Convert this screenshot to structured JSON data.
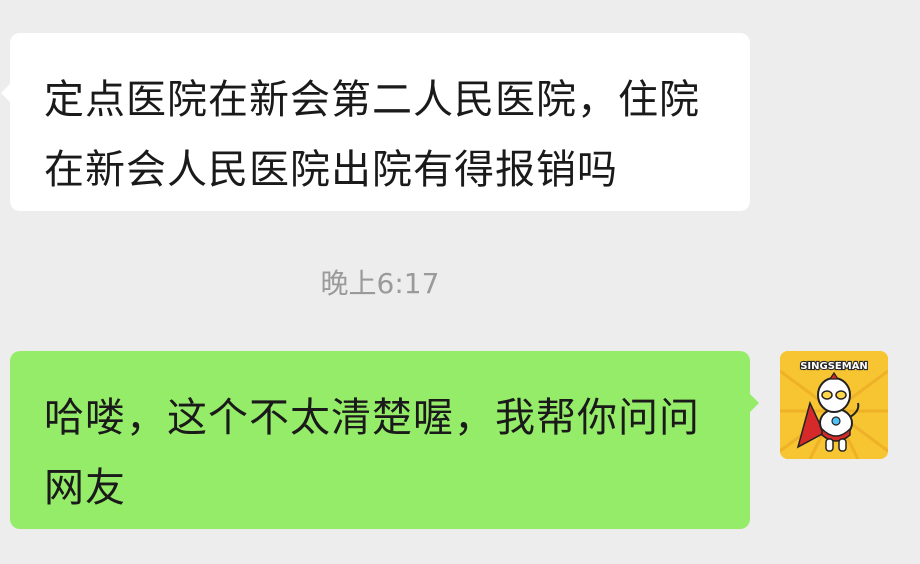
{
  "messages": [
    {
      "direction": "incoming",
      "text": "定点医院在新会第二人民医院，住院在新会人民医院出院有得报销吗"
    },
    {
      "direction": "outgoing",
      "text": "哈喽，这个不太清楚喔，我帮你问问网友"
    }
  ],
  "timestamp": "晚上6:17",
  "avatar": {
    "label": "SINGSEMAN",
    "icon": "cartoon-hero-icon"
  },
  "colors": {
    "background": "#ededed",
    "incoming_bubble": "#ffffff",
    "outgoing_bubble": "#95ec69",
    "timestamp": "#9a9a9a",
    "avatar_bg": "#f7c531"
  }
}
